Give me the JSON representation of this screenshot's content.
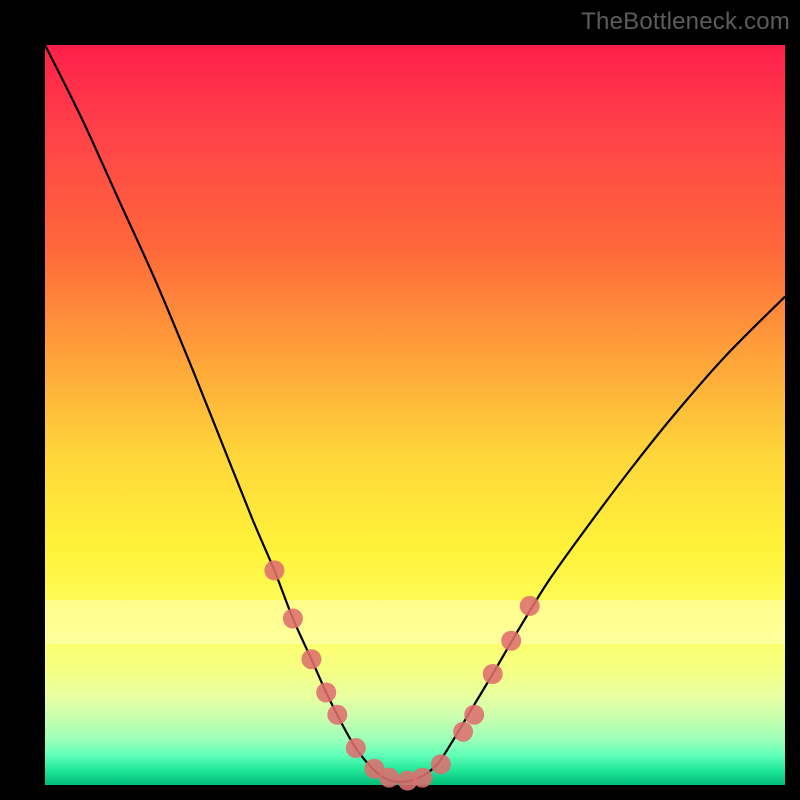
{
  "watermark": "TheBottleneck.com",
  "chart_data": {
    "type": "line",
    "title": "",
    "xlabel": "",
    "ylabel": "",
    "xlim": [
      0,
      1
    ],
    "ylim": [
      0,
      1
    ],
    "grid": false,
    "legend": false,
    "series": [
      {
        "name": "bottleneck-curve",
        "color": "#000000",
        "x": [
          0.0,
          0.05,
          0.1,
          0.15,
          0.2,
          0.24,
          0.28,
          0.31,
          0.335,
          0.36,
          0.38,
          0.4,
          0.42,
          0.44,
          0.455,
          0.47,
          0.49,
          0.51,
          0.53,
          0.55,
          0.575,
          0.605,
          0.64,
          0.68,
          0.73,
          0.79,
          0.85,
          0.92,
          1.0
        ],
        "y": [
          1.0,
          0.9,
          0.79,
          0.68,
          0.56,
          0.46,
          0.36,
          0.29,
          0.225,
          0.17,
          0.125,
          0.085,
          0.05,
          0.025,
          0.012,
          0.005,
          0.005,
          0.012,
          0.028,
          0.058,
          0.1,
          0.15,
          0.21,
          0.275,
          0.345,
          0.425,
          0.5,
          0.58,
          0.66
        ]
      }
    ],
    "markers": {
      "name": "highlighted-points",
      "color": "#de6e6e",
      "radius_px": 10,
      "x": [
        0.31,
        0.335,
        0.36,
        0.38,
        0.395,
        0.42,
        0.445,
        0.465,
        0.49,
        0.51,
        0.535,
        0.565,
        0.58,
        0.605,
        0.63,
        0.655
      ],
      "y": [
        0.29,
        0.225,
        0.17,
        0.125,
        0.095,
        0.05,
        0.022,
        0.01,
        0.006,
        0.01,
        0.028,
        0.072,
        0.095,
        0.15,
        0.195,
        0.242
      ]
    },
    "pale_band_y": [
      0.19,
      0.25
    ],
    "gradient_stops": [
      {
        "pos": 0.0,
        "color": "#ff1f4a"
      },
      {
        "pos": 0.56,
        "color": "#ffd83a"
      },
      {
        "pos": 0.84,
        "color": "#f7ff80"
      },
      {
        "pos": 1.0,
        "color": "#00c078"
      }
    ]
  }
}
